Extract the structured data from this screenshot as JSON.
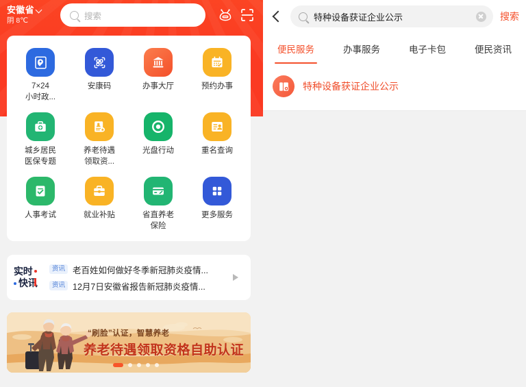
{
  "left": {
    "location": {
      "name": "安徽省",
      "weather": "阴 8℃",
      "chevron_icon": "chevron-down-icon"
    },
    "search": {
      "placeholder": "搜索",
      "icon": "search-icon"
    },
    "header_icons": [
      {
        "name": "robot-assistant-icon",
        "label": "智能机器人"
      },
      {
        "name": "scan-code-icon",
        "label": "扫一扫"
      }
    ],
    "apps": [
      {
        "label": "7×24\n小时政...",
        "line1": "7×24",
        "line2": "小时政...",
        "icon": "government-service-icon",
        "color": "#2d6ae0"
      },
      {
        "label": "安康码",
        "line1": "安康码",
        "line2": "",
        "icon": "qr-health-code-icon",
        "color": "#3359d8"
      },
      {
        "label": "办事大厅",
        "line1": "办事大厅",
        "line2": "",
        "icon": "service-hall-icon",
        "color": "#f4643c"
      },
      {
        "label": "预约办事",
        "line1": "预约办事",
        "line2": "",
        "icon": "calendar-booking-icon",
        "color": "#f9b325"
      },
      {
        "label": "城乡居民\n医保专题",
        "line1": "城乡居民",
        "line2": "医保专题",
        "icon": "medical-kit-icon",
        "color": "#22b573"
      },
      {
        "label": "养老待遇\n领取资...",
        "line1": "养老待遇",
        "line2": "领取资...",
        "icon": "pension-document-icon",
        "color": "#f9b325"
      },
      {
        "label": "光盘行动",
        "line1": "光盘行动",
        "line2": "",
        "icon": "clean-plate-icon",
        "color": "#16b46a"
      },
      {
        "label": "重名查询",
        "line1": "重名查询",
        "line2": "",
        "icon": "name-lookup-icon",
        "color": "#f9b325"
      },
      {
        "label": "人事考试",
        "line1": "人事考试",
        "line2": "",
        "icon": "exam-clipboard-icon",
        "color": "#2cb86a"
      },
      {
        "label": "就业补贴",
        "line1": "就业补贴",
        "line2": "",
        "icon": "briefcase-subsidy-icon",
        "color": "#f9b325"
      },
      {
        "label": "省直养老\n保险",
        "line1": "省直养老",
        "line2": "保险",
        "icon": "insurance-card-icon",
        "color": "#22b573"
      },
      {
        "label": "更多服务",
        "line1": "更多服务",
        "line2": "",
        "icon": "more-grid-icon",
        "color": "#3359d8"
      }
    ],
    "news": {
      "logo_line1": "实时",
      "logo_line2": "快讯",
      "arrow_icon": "play-arrow-icon",
      "items": [
        {
          "tag": "资讯",
          "text": "老百姓如何做好冬季新冠肺炎疫情..."
        },
        {
          "tag": "资讯",
          "text": "12月7日安徽省报告新冠肺炎疫情..."
        }
      ]
    },
    "banner": {
      "subtitle": "“刷脸”认证，智慧养老",
      "title": "养老待遇领取资格自助认证",
      "dots_total": 5,
      "dots_active": 1,
      "illustration": "elderly-couple-with-suitcase-illustration"
    }
  },
  "right": {
    "back_icon": "back-arrow-icon",
    "search": {
      "icon": "search-icon",
      "value": "特种设备获证企业公示",
      "clear_icon": "clear-circle-icon",
      "button_label": "搜索"
    },
    "tabs": [
      {
        "label": "便民服务",
        "active": true
      },
      {
        "label": "办事服务",
        "active": false
      },
      {
        "label": "电子卡包",
        "active": false
      },
      {
        "label": "便民资讯",
        "active": false
      }
    ],
    "results": [
      {
        "label": "特种设备获证企业公示",
        "icon": "certificate-document-icon"
      }
    ]
  },
  "colors": {
    "brand_red": "#fb3b22",
    "accent_orange": "#f4502b",
    "tag_blue": "#4b7dd6",
    "page_bg": "#f2f2f2"
  }
}
